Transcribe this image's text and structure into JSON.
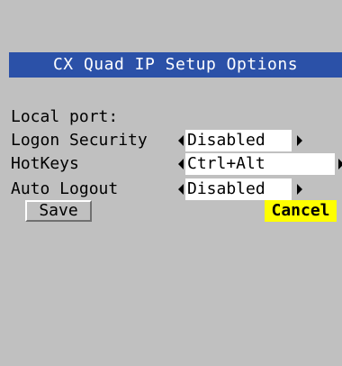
{
  "window": {
    "title": "CX Quad IP Setup Options"
  },
  "form": {
    "local_port_label": "Local port:",
    "rows": [
      {
        "label": "Logon Security",
        "value": "Disabled"
      },
      {
        "label": "HotKeys",
        "value": "Ctrl+Alt"
      },
      {
        "label": "Auto Logout",
        "value": "Disabled"
      }
    ]
  },
  "buttons": {
    "save": "Save",
    "cancel": "Cancel"
  },
  "colors": {
    "background": "#c0c0c0",
    "title_bar": "#2b51a8",
    "title_text": "#ffffff",
    "field_bg": "#ffffff",
    "focus_highlight": "#ffff00"
  },
  "icons": {
    "decrement": "left-arrow-icon",
    "increment": "right-arrow-icon"
  }
}
